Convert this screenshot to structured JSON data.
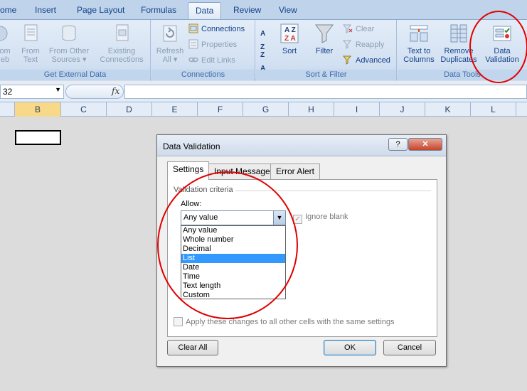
{
  "tabs": [
    "ome",
    "Insert",
    "Page Layout",
    "Formulas",
    "Data",
    "Review",
    "View"
  ],
  "active_tab": "Data",
  "ribbon": {
    "get_external_data": {
      "label": "Get External Data",
      "from_web": [
        "om",
        "eb"
      ],
      "from_text": [
        "From",
        "Text"
      ],
      "from_other_sources": [
        "From Other",
        "Sources ▾"
      ],
      "existing_connections": [
        "Existing",
        "Connections"
      ]
    },
    "connections": {
      "label": "Connections",
      "refresh_all": [
        "Refresh",
        "All ▾"
      ],
      "connections_btn": "Connections",
      "properties": "Properties",
      "edit_links": "Edit Links"
    },
    "sort_filter": {
      "label": "Sort & Filter",
      "sort": "Sort",
      "filter": "Filter",
      "clear": "Clear",
      "reapply": "Reapply",
      "advanced": "Advanced"
    },
    "data_tools": {
      "label": "Data Tools",
      "text_to_columns": [
        "Text to",
        "Columns"
      ],
      "remove_duplicates": [
        "Remove",
        "Duplicates"
      ],
      "data_validation": [
        "Data",
        "Validation"
      ]
    }
  },
  "formula_bar": {
    "name_box": "32",
    "fx": "fx",
    "value": ""
  },
  "columns": [
    "B",
    "C",
    "D",
    "E",
    "F",
    "G",
    "H",
    "I",
    "J",
    "K",
    "L"
  ],
  "selected_column": "B",
  "dialog": {
    "title": "Data Validation",
    "help": "?",
    "close": "✕",
    "tabs": [
      "Settings",
      "Input Message",
      "Error Alert"
    ],
    "active_tab": "Settings",
    "section_title": "Validation criteria",
    "allow_label": "Allow:",
    "allow_value": "Any value",
    "ignore_blank": "Ignore blank",
    "options": [
      "Any value",
      "Whole number",
      "Decimal",
      "List",
      "Date",
      "Time",
      "Text length",
      "Custom"
    ],
    "highlighted_option": "List",
    "apply_all": "Apply these changes to all other cells with the same settings",
    "buttons": {
      "clear_all": "Clear All",
      "ok": "OK",
      "cancel": "Cancel"
    }
  },
  "colors": {
    "annotation": "#e00000",
    "ribbon_bg": "#d3e1f2",
    "selection": "#3399ff"
  }
}
